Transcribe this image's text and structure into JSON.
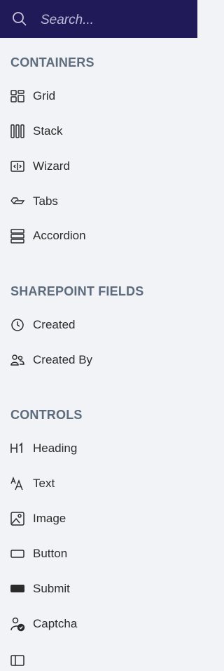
{
  "search": {
    "placeholder": "Search..."
  },
  "sections": {
    "containers": {
      "title": "CONTAINERS",
      "items": [
        "Grid",
        "Stack",
        "Wizard",
        "Tabs",
        "Accordion"
      ]
    },
    "sharepoint_fields": {
      "title": "SHAREPOINT FIELDS",
      "items": [
        "Created",
        "Created By"
      ]
    },
    "controls": {
      "title": "CONTROLS",
      "items": [
        "Heading",
        "Text",
        "Image",
        "Button",
        "Submit",
        "Captcha"
      ]
    }
  },
  "icons": {
    "grid": "grid-icon",
    "stack": "stack-icon",
    "wizard": "wizard-icon",
    "tabs": "tabs-icon",
    "accordion": "accordion-icon",
    "created": "clock-icon",
    "created_by": "users-icon",
    "heading": "heading-h1-icon",
    "text": "text-size-icon",
    "image": "image-icon",
    "button": "button-outline-icon",
    "submit": "submit-filled-icon",
    "captcha": "user-check-icon"
  },
  "colors": {
    "header_bg": "#201b58",
    "panel_bg": "#f1f3f6",
    "section_title": "#5d6b7d",
    "item_text": "#2b2b2b"
  }
}
